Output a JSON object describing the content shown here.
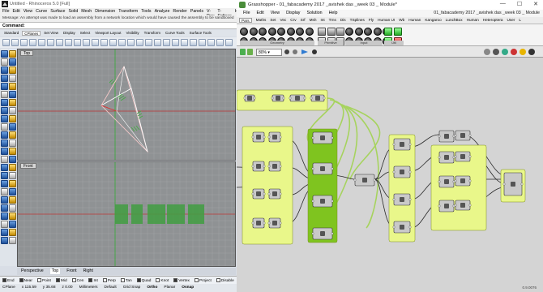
{
  "rhino": {
    "title": "Untitled - Rhinoceros 5.0 [Full]",
    "menu": [
      "File",
      "Edit",
      "View",
      "Curve",
      "Surface",
      "Solid",
      "Mesh",
      "Dimension",
      "Transform",
      "Tools",
      "Analyze",
      "Render",
      "Panels",
      "V-Ray",
      "T-Splines",
      "Help"
    ],
    "message": "Message: An attempt was made to load an assembly from a network location which would have caused the assembly to be sandboxed",
    "command": "Command:",
    "tabs": [
      "Standard",
      "CPlanes",
      "Set View",
      "Display",
      "Select",
      "Viewport Layout",
      "Visibility",
      "Transform",
      "Curve Tools",
      "Surface Tools"
    ],
    "viewport_top_label": "Top",
    "viewport_front_label": "Front",
    "viewport_tabs": [
      "Perspective",
      "Top",
      "Front",
      "Right"
    ],
    "osnaps": [
      {
        "label": "End",
        "on": true
      },
      {
        "label": "Near",
        "on": true
      },
      {
        "label": "Point",
        "on": false
      },
      {
        "label": "Mid",
        "on": true
      },
      {
        "label": "Cen",
        "on": false
      },
      {
        "label": "Int",
        "on": true
      },
      {
        "label": "Perp",
        "on": false
      },
      {
        "label": "Tan",
        "on": false
      },
      {
        "label": "Quad",
        "on": true
      },
      {
        "label": "Knot",
        "on": false
      },
      {
        "label": "Vertex",
        "on": true
      },
      {
        "label": "Project",
        "on": false
      },
      {
        "label": "Disable",
        "on": false
      }
    ],
    "status": {
      "cplane": "CPlane",
      "x": "x 115.59",
      "y": "y 35.68",
      "z": "z 0.00",
      "units": "Millimeters",
      "layer": "Default",
      "grid_snap": "Grid Snap",
      "ortho": "Ortho",
      "planar": "Planar",
      "osnap": "Osnap"
    }
  },
  "grasshopper": {
    "title": "Grasshopper - 01_fabacademy 2017 _avishek das _week 03 _ Module*",
    "window_controls": [
      "—",
      "☐",
      "✕"
    ],
    "menu": [
      "File",
      "Edit",
      "View",
      "Display",
      "Solution",
      "Help"
    ],
    "document_name": "01_fabacademy 2017 _avishek das _week 03 _ Module",
    "tabs": [
      "Pars",
      "Maths",
      "Set",
      "Vec",
      "Crv",
      "Srf",
      "Msh",
      "Int",
      "Trns",
      "Dis",
      "TSplines",
      "Fly",
      "Human UI",
      "Wb",
      "Human",
      "Kangaroo",
      "LunchBox",
      "Human",
      "Heteroptera",
      "User",
      "L"
    ],
    "ribbon_groups": [
      "Geometry",
      "Primitive",
      "Input",
      "Util"
    ],
    "zoom": "80%",
    "version": "0.9.0076"
  },
  "colors": {
    "group_fill": "#e9f78a",
    "group_fill_dark": "#7fc41f",
    "wire": "#2a2a2a",
    "wire_green": "#9fd34a"
  }
}
